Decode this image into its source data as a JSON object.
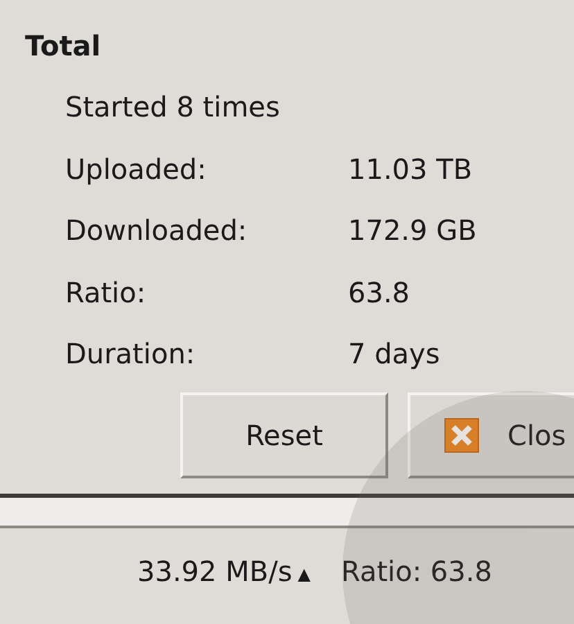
{
  "section": {
    "title": "Total"
  },
  "summary": "Started 8 times",
  "stats": [
    {
      "label": "Uploaded:",
      "value": "11.03 TB"
    },
    {
      "label": "Downloaded:",
      "value": "172.9 GB"
    },
    {
      "label": "Ratio:",
      "value": "63.8"
    },
    {
      "label": "Duration:",
      "value": "7 days"
    }
  ],
  "buttons": [
    {
      "label": "Reset",
      "kind": "plain"
    },
    {
      "label": "Clos",
      "kind": "close"
    }
  ],
  "status_bar": {
    "speed": "33.92 MB/s",
    "arrow": "▲",
    "ratio": "Ratio: 63.8"
  }
}
